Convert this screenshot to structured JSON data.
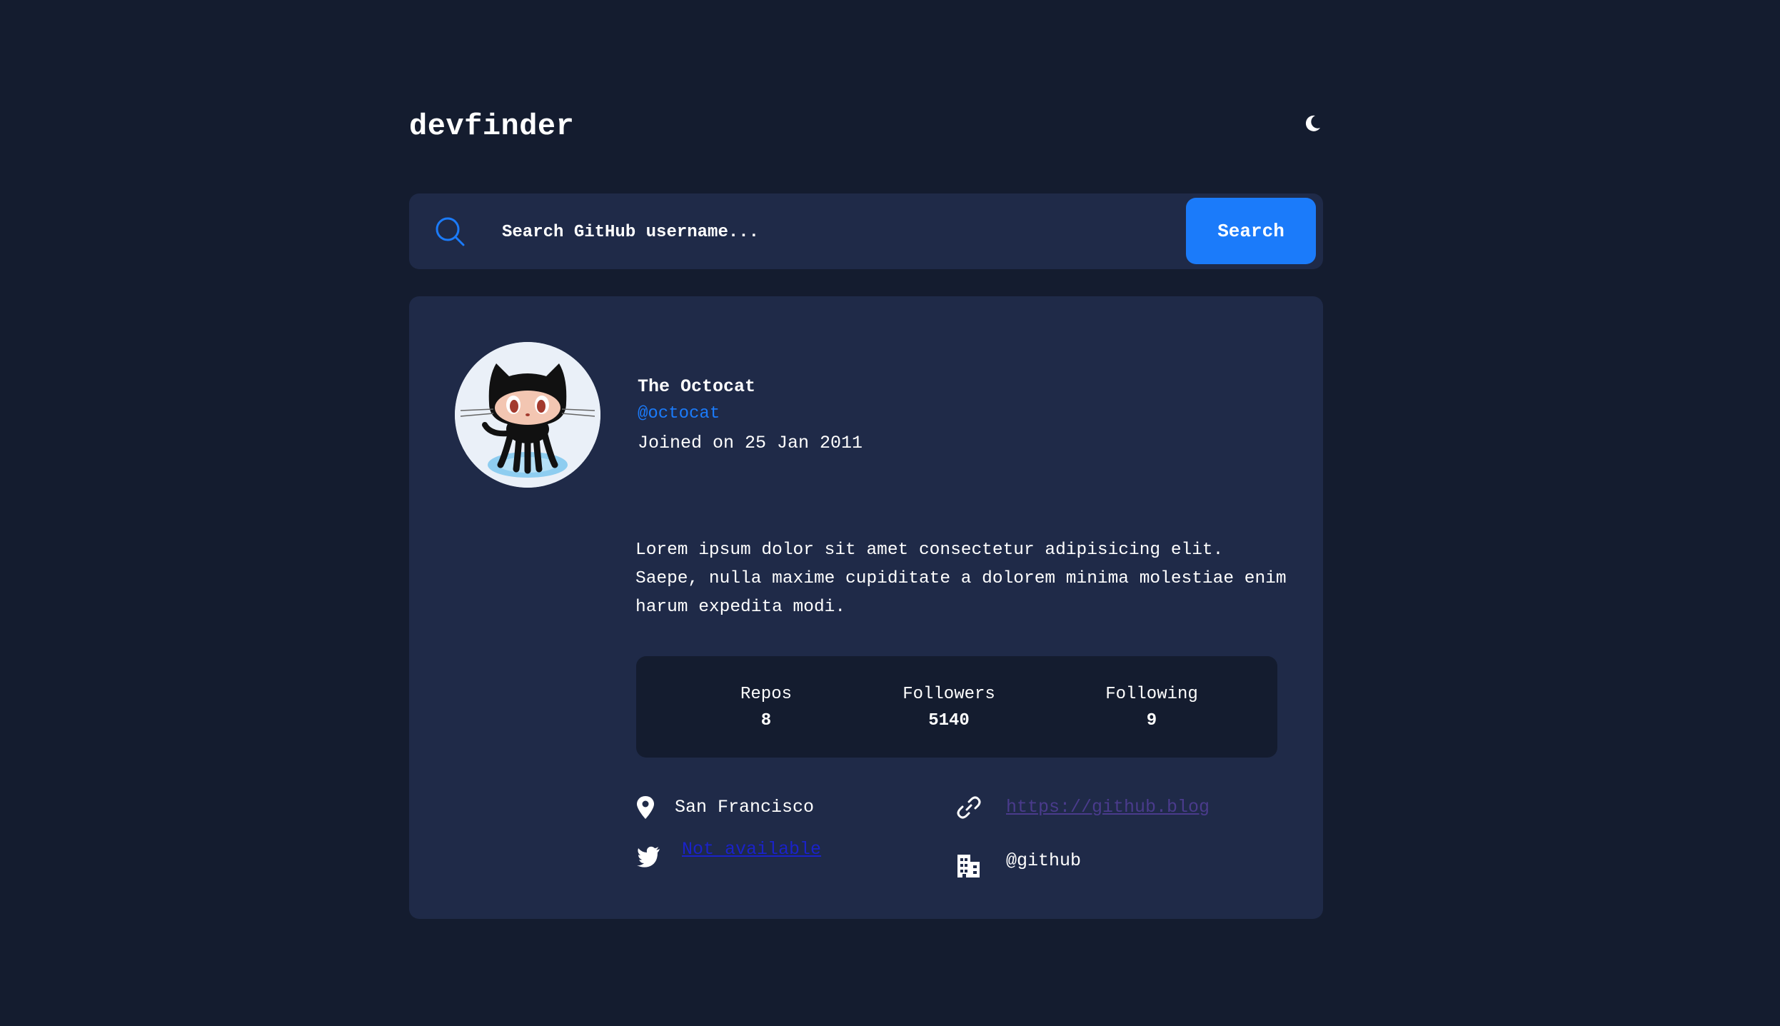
{
  "header": {
    "logo": "devfinder",
    "theme_icon": "moon-icon"
  },
  "search": {
    "placeholder": "Search GitHub username...",
    "button_label": "Search",
    "icon": "search-icon"
  },
  "profile": {
    "name": "The Octocat",
    "login": "@octocat",
    "joined": "Joined on 25 Jan 2011",
    "bio": "Lorem ipsum dolor sit amet consectetur adipisicing elit. Saepe, nulla maxime cupiditate a dolorem minima molestiae enim harum expedita modi.",
    "avatar_icon": "octocat-avatar"
  },
  "stats": {
    "repos_label": "Repos",
    "repos_value": "8",
    "followers_label": "Followers",
    "followers_value": "5140",
    "following_label": "Following",
    "following_value": "9"
  },
  "links": {
    "location": "San Francisco",
    "blog": "https://github.blog",
    "twitter": "Not available",
    "company": "@github"
  },
  "colors": {
    "background": "#141c2f",
    "card": "#1f2a48",
    "accent": "#1b7bfa",
    "text": "#ffffff"
  }
}
